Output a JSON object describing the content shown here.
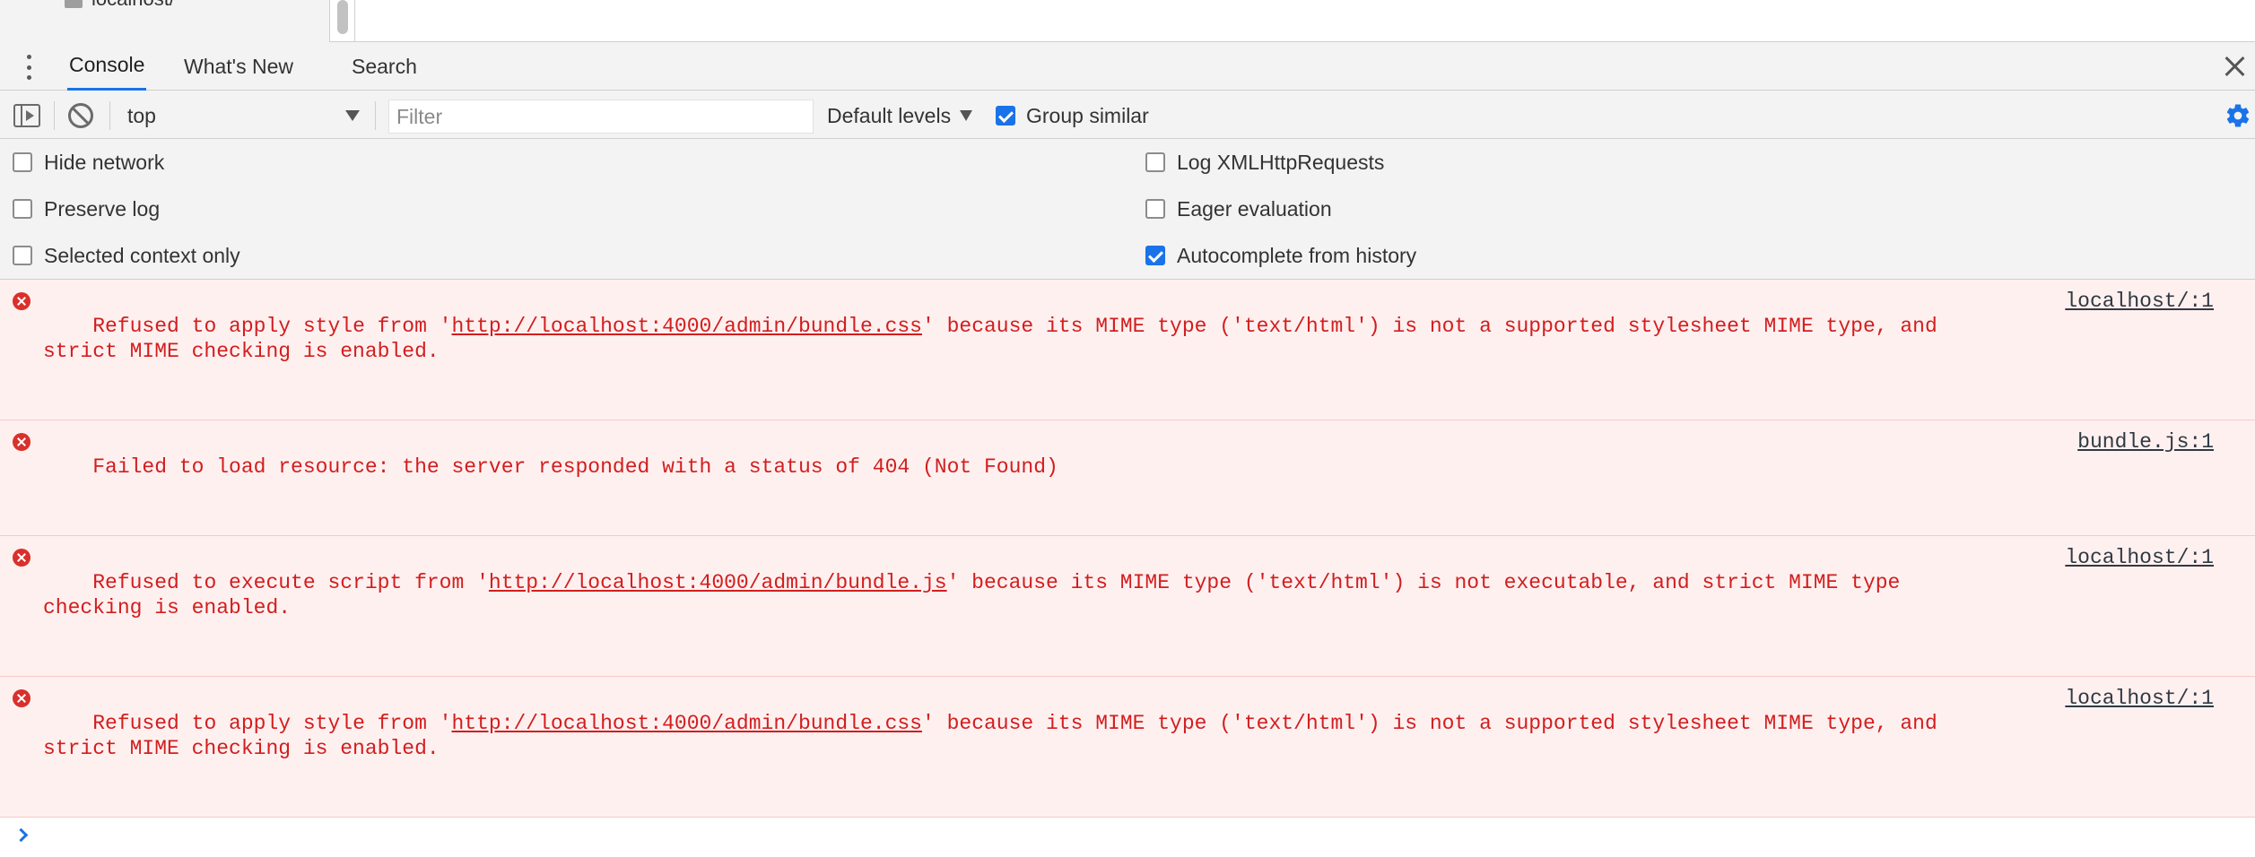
{
  "elements_panel": {
    "tree_item_label": "localhost/"
  },
  "drawer": {
    "tabs": [
      {
        "label": "Console",
        "active": true
      },
      {
        "label": "What's New",
        "active": false
      },
      {
        "label": "Search",
        "active": false
      }
    ]
  },
  "toolbar": {
    "context": "top",
    "filter_placeholder": "Filter",
    "levels_label": "Default levels",
    "group_similar_label": "Group similar",
    "group_similar_checked": true
  },
  "settings": {
    "left": [
      {
        "label": "Hide network",
        "checked": false
      },
      {
        "label": "Preserve log",
        "checked": false
      },
      {
        "label": "Selected context only",
        "checked": false
      }
    ],
    "right": [
      {
        "label": "Log XMLHttpRequests",
        "checked": false
      },
      {
        "label": "Eager evaluation",
        "checked": false
      },
      {
        "label": "Autocomplete from history",
        "checked": true
      }
    ]
  },
  "messages": [
    {
      "level": "error",
      "prefix": "Refused to apply style from '",
      "link": "http://localhost:4000/admin/bundle.css",
      "suffix": "' because its MIME type ('text/html') is not a supported stylesheet MIME type, and strict MIME checking is enabled.",
      "source": "localhost/:1"
    },
    {
      "level": "error",
      "prefix": "Failed to load resource: the server responded with a status of 404 (Not Found)",
      "link": "",
      "suffix": "",
      "source": "bundle.js:1"
    },
    {
      "level": "error",
      "prefix": "Refused to execute script from '",
      "link": "http://localhost:4000/admin/bundle.js",
      "suffix": "' because its MIME type ('text/html') is not executable, and strict MIME type checking is enabled.",
      "source": "localhost/:1"
    },
    {
      "level": "error",
      "prefix": "Refused to apply style from '",
      "link": "http://localhost:4000/admin/bundle.css",
      "suffix": "' because its MIME type ('text/html') is not a supported stylesheet MIME type, and strict MIME checking is enabled.",
      "source": "localhost/:1"
    }
  ],
  "colors": {
    "accent": "#1a73e8",
    "error_text": "#d21e1e",
    "error_bg": "#fff0f0"
  }
}
